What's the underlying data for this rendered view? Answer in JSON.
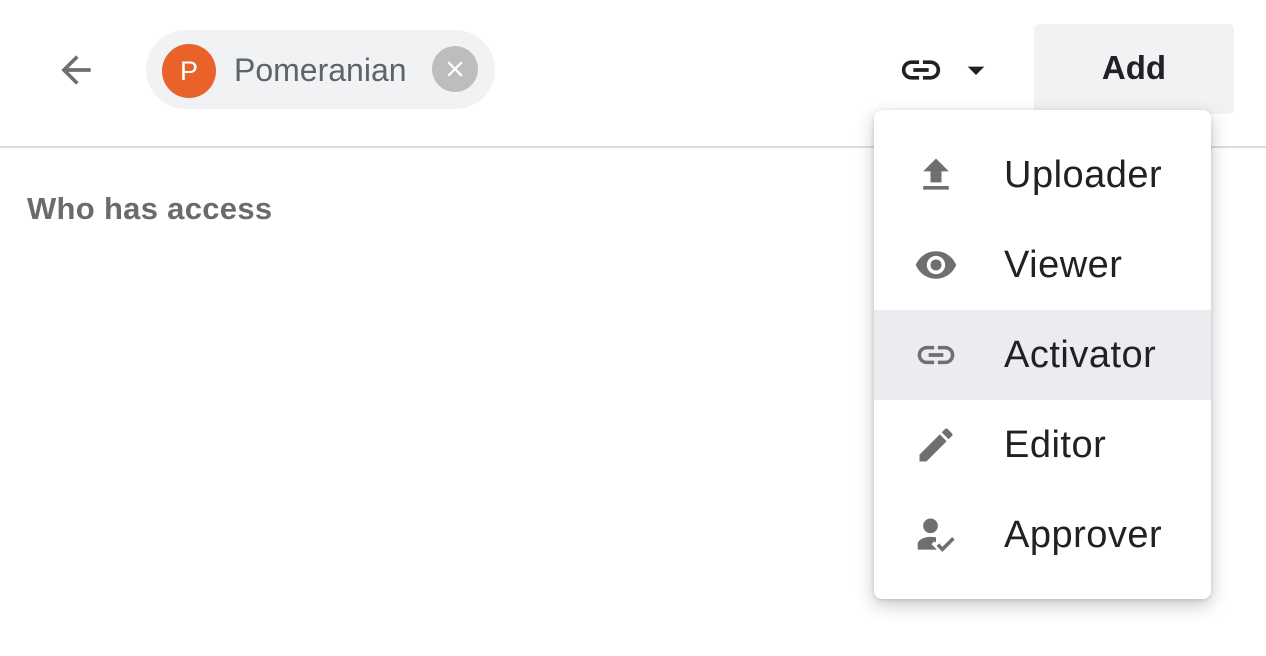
{
  "header": {
    "back_icon": "arrow-left-icon",
    "chip": {
      "avatar_letter": "P",
      "label": "Pomeranian",
      "avatar_color": "#e8622a",
      "remove_icon": "close-circle-icon"
    },
    "link_dropdown": {
      "icon": "link-icon",
      "caret_icon": "caret-down-icon"
    },
    "add_label": "Add"
  },
  "section": {
    "title": "Who has access"
  },
  "menu": {
    "items": [
      {
        "label": "Uploader",
        "icon": "upload-icon",
        "active": false
      },
      {
        "label": "Viewer",
        "icon": "eye-icon",
        "active": false
      },
      {
        "label": "Activator",
        "icon": "link-icon",
        "active": true
      },
      {
        "label": "Editor",
        "icon": "pencil-icon",
        "active": false
      },
      {
        "label": "Approver",
        "icon": "person-check-icon",
        "active": false
      }
    ]
  },
  "colors": {
    "accent": "#e8622a",
    "active_bg": "#ebecef",
    "chip_bg": "#f1f2f4"
  }
}
